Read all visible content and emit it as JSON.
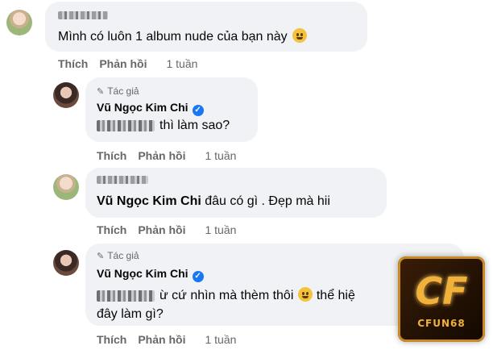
{
  "comments": [
    {
      "id": "c1",
      "text": "Mình có luôn 1 album nude của bạn này",
      "actions": {
        "like": "Thích",
        "reply": "Phản hồi",
        "time": "1 tuần"
      }
    },
    {
      "id": "c2",
      "author_tag": "Tác giả",
      "author": "Vũ Ngọc Kim Chi",
      "text": "thì làm sao?",
      "actions": {
        "like": "Thích",
        "reply": "Phản hồi",
        "time": "1 tuần"
      }
    },
    {
      "id": "c3",
      "mention": "Vũ Ngọc Kim Chi",
      "text": "đâu có gì . Đẹp mà hii",
      "actions": {
        "like": "Thích",
        "reply": "Phản hồi",
        "time": "1 tuần"
      }
    },
    {
      "id": "c4",
      "author_tag": "Tác giả",
      "author": "Vũ Ngọc Kim Chi",
      "text_line1_a": "ừ cứ nhìn mà thèm thôi",
      "text_line1_b": "thể hiệ",
      "text_line2": "đây làm gì?",
      "actions": {
        "like": "Thích",
        "reply": "Phản hồi",
        "time": "1 tuần"
      }
    }
  ],
  "watermark": {
    "mono": "CF",
    "word": "CFUN68"
  },
  "colors": {
    "bubble": "#f0f2f5",
    "secondary_text": "#65676b",
    "verified": "#1877f2"
  }
}
